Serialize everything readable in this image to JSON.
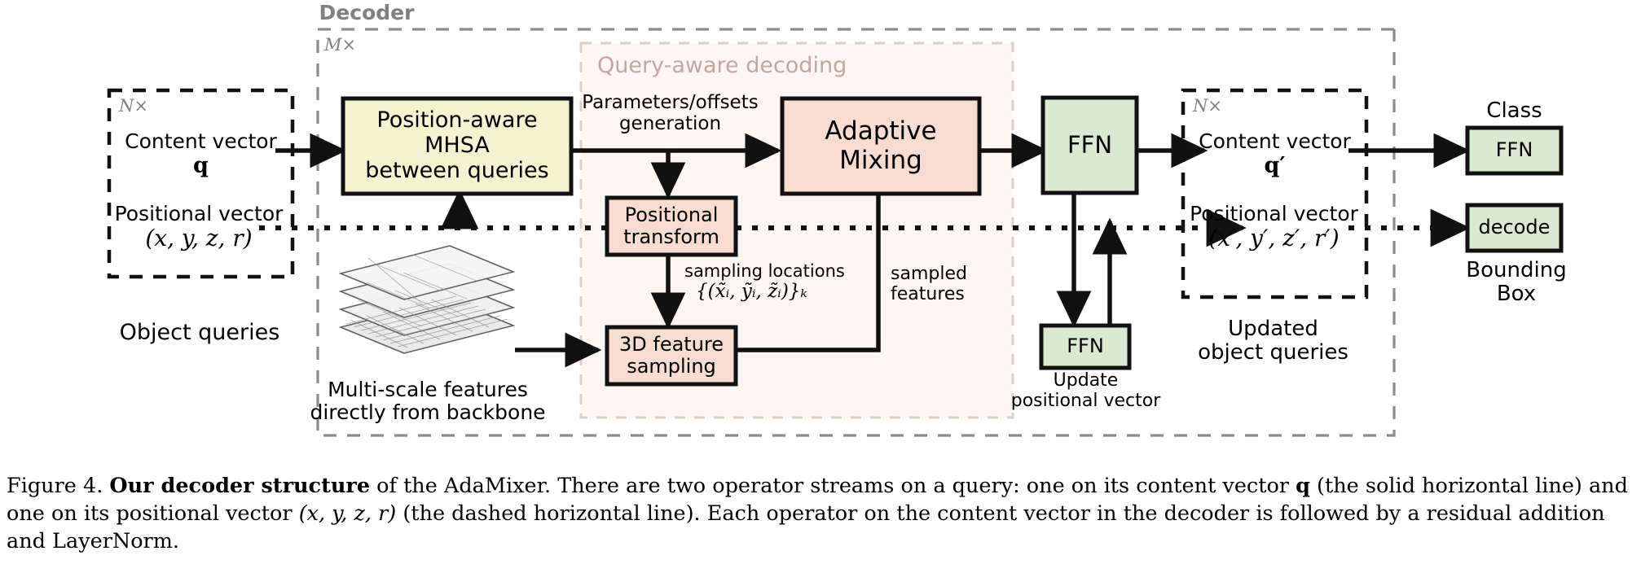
{
  "figure": {
    "id": "figure-4-adamixer-decoder",
    "decoder_group_label": "Decoder",
    "decoder_repeat": "M×",
    "query_aware_label": "Query-aware decoding"
  },
  "object_queries": {
    "repeat": "N×",
    "content_label": "Content vector",
    "content_symbol": "q",
    "positional_label": "Positional vector",
    "positional_symbol": "(x, y, z, r)",
    "caption": "Object queries"
  },
  "updated_queries": {
    "repeat": "N×",
    "content_label": "Content vector",
    "content_symbol": "q′",
    "positional_label": "Positional vector",
    "positional_symbol": "(x′, y′, z′, r′)",
    "caption_line1": "Updated",
    "caption_line2": "object queries"
  },
  "blocks": {
    "mhsa": {
      "line1": "Position-aware",
      "line2": "MHSA",
      "line3": "between queries",
      "fill": "#f4f3cf"
    },
    "positional_transform": {
      "line1": "Positional",
      "line2": "transform",
      "fill": "#f7dccf"
    },
    "feature_sampling": {
      "line1": "3D feature",
      "line2": "sampling",
      "fill": "#f7dccf"
    },
    "adaptive_mixing": {
      "line1": "Adaptive",
      "line2": "Mixing",
      "fill": "#f7dccf"
    },
    "ffn_main": {
      "label": "FFN",
      "fill": "#dae9d1"
    },
    "ffn_update": {
      "label": "FFN",
      "fill": "#dae9d1"
    },
    "ffn_class": {
      "label": "FFN",
      "fill": "#dae9d1"
    },
    "decode": {
      "label": "decode",
      "fill": "#dae9d1"
    }
  },
  "edge_labels": {
    "params_offsets_line1": "Parameters/offsets",
    "params_offsets_line2": "generation",
    "sampling_locations_line1": "sampling locations",
    "sampling_locations_line2": "{(x̃ᵢ, ỹᵢ, z̃ᵢ)}ₖ",
    "sampled_line1": "sampled",
    "sampled_line2": "features",
    "update_pos_line1": "Update",
    "update_pos_line2": "positional vector"
  },
  "backbone": {
    "line1": "Multi-scale features",
    "line2": "directly from backbone"
  },
  "outputs": {
    "class_label": "Class",
    "bbox_line1": "Bounding",
    "bbox_line2": "Box"
  },
  "caption": {
    "prefix": "Figure 4.",
    "bold": "Our decoder structure",
    "rest_a": " of the AdaMixer.  There are two operator streams on a query:  one on its content vector ",
    "q": "q",
    "rest_b": " (the solid horizontal line) and one on its positional vector ",
    "xyzr": "(x, y, z, r)",
    "rest_c": " (the dashed horizontal line).  Each operator on the content vector in the decoder is followed by a residual addition and LayerNorm."
  },
  "colors": {
    "yellow": "#f4f3cf",
    "pink": "#f7dccf",
    "green": "#dae9d1",
    "query_aware_bg": "#fdf6f3",
    "query_aware_border": "#e0cdc6",
    "decoder_border": "#8c8c8c",
    "stroke": "#111111"
  }
}
